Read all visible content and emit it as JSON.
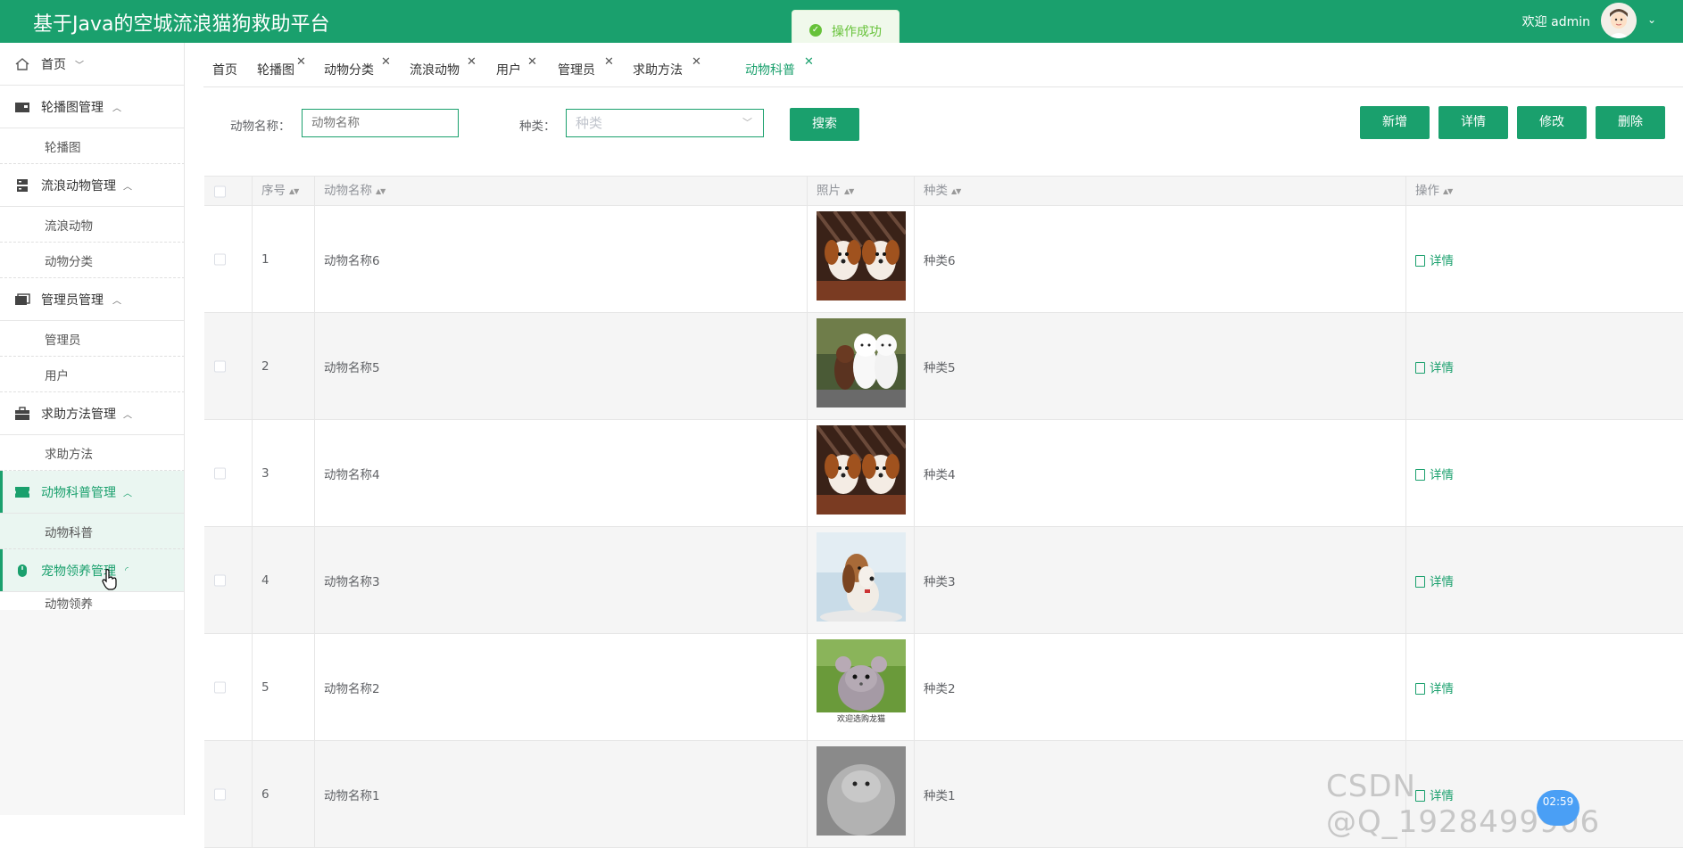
{
  "app": {
    "title": "基于Java的空城流浪猫狗救助平台",
    "welcome": "欢迎 admin",
    "accent": "#1aa06d"
  },
  "toast": {
    "icon": "check-circle-icon",
    "message": "操作成功"
  },
  "sidebar": {
    "home": "首页",
    "groups": [
      {
        "label": "轮播图管理",
        "icon": "carousel-icon",
        "items": [
          "轮播图"
        ]
      },
      {
        "label": "流浪动物管理",
        "icon": "server-icon",
        "items": [
          "流浪动物",
          "动物分类"
        ]
      },
      {
        "label": "管理员管理",
        "icon": "folder-icon",
        "items": [
          "管理员",
          "用户"
        ]
      },
      {
        "label": "求助方法管理",
        "icon": "briefcase-icon",
        "items": [
          "求助方法"
        ]
      },
      {
        "label": "动物科普管理",
        "icon": "ticket-icon",
        "items": [
          "动物科普"
        ]
      },
      {
        "label": "宠物领养管理",
        "icon": "mouse-icon",
        "items": [
          "动物领养"
        ]
      }
    ]
  },
  "tabs": [
    "首页",
    "轮播图",
    "动物分类",
    "流浪动物",
    "用户",
    "管理员",
    "求助方法",
    "动物科普"
  ],
  "filters": {
    "name_label": "动物名称：",
    "name_placeholder": "动物名称",
    "type_label": "种类：",
    "type_placeholder": "种类",
    "search": "搜索"
  },
  "actions": {
    "add": "新增",
    "detail": "详情",
    "edit": "修改",
    "delete": "删除"
  },
  "table": {
    "headers": [
      "序号",
      "动物名称",
      "照片",
      "种类",
      "操作"
    ],
    "rows": [
      {
        "no": "1",
        "name": "动物名称6",
        "type": "种类6",
        "op": "详情",
        "photo": "puppies-icon"
      },
      {
        "no": "2",
        "name": "动物名称5",
        "type": "种类5",
        "op": "详情",
        "photo": "poodles-icon"
      },
      {
        "no": "3",
        "name": "动物名称4",
        "type": "种类4",
        "op": "详情",
        "photo": "puppies-icon"
      },
      {
        "no": "4",
        "name": "动物名称3",
        "type": "种类3",
        "op": "详情",
        "photo": "beagle-icon"
      },
      {
        "no": "5",
        "name": "动物名称2",
        "type": "种类2",
        "op": "详情",
        "photo": "chinchilla-icon",
        "caption": "欢迎选购龙猫"
      },
      {
        "no": "6",
        "name": "动物名称1",
        "type": "种类1",
        "op": "详情",
        "photo": "chinchilla-icon"
      }
    ]
  },
  "overlay": {
    "watermark": "CSDN @Q_1928499906",
    "timer": "02:59"
  }
}
